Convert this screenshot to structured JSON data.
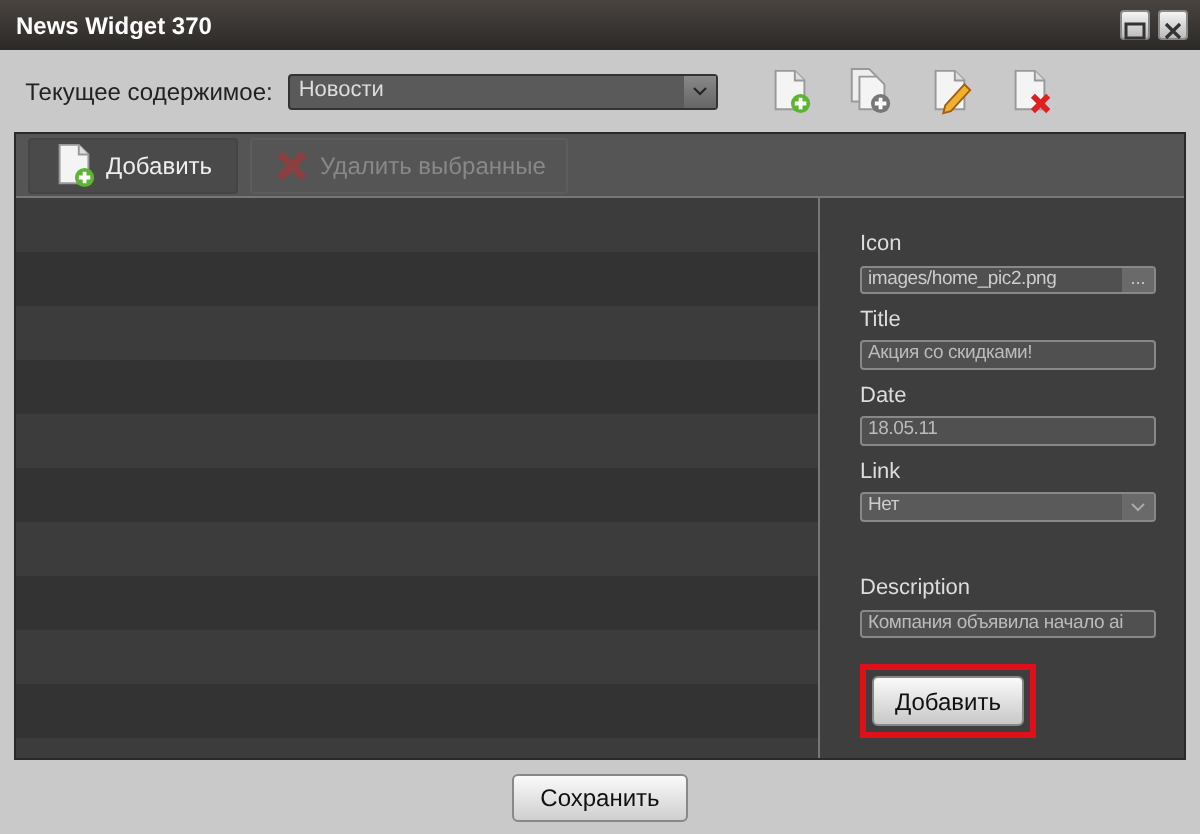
{
  "window": {
    "title": "News Widget 370"
  },
  "content_selector": {
    "label": "Текущее содержимое:",
    "value": "Новости"
  },
  "header_tools": [
    {
      "kind": "add"
    },
    {
      "kind": "copy"
    },
    {
      "kind": "edit"
    },
    {
      "kind": "delete"
    }
  ],
  "toolbar": [
    {
      "label": "Добавить",
      "kind": "add",
      "disabled": false
    },
    {
      "label": "Удалить выбранные",
      "kind": "delete",
      "disabled": true
    }
  ],
  "form": {
    "fields": [
      {
        "label": "Icon",
        "kind": "file",
        "value": "images/home_pic2.png",
        "button": "..."
      },
      {
        "label": "Title",
        "kind": "text",
        "value": "Акция со скидками!"
      },
      {
        "label": "Date",
        "kind": "text",
        "value": "18.05.11"
      },
      {
        "label": "Link",
        "kind": "select",
        "value": "Нет"
      },
      {
        "label": "Description",
        "kind": "text",
        "value": "Компания объявила начало ai"
      }
    ],
    "add_button": {
      "label": "Добавить",
      "highlighted": true
    }
  },
  "save_button": {
    "label": "Сохранить"
  }
}
